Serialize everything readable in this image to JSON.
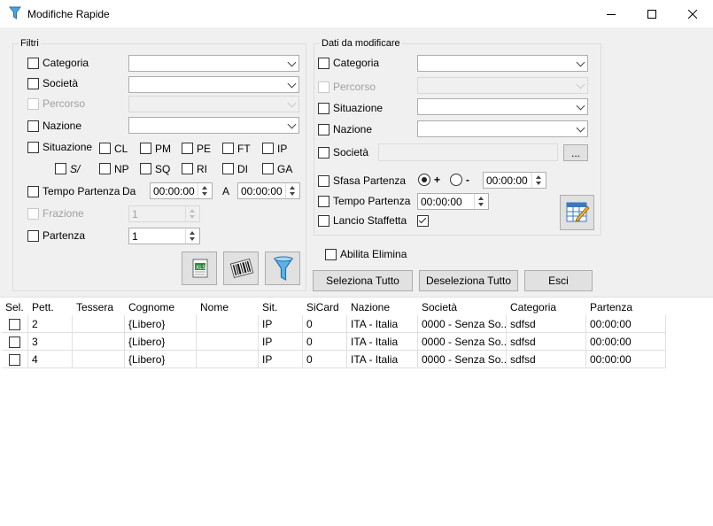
{
  "window": {
    "title": "Modifiche Rapide"
  },
  "filtri": {
    "group_label": "Filtri",
    "categoria_label": "Categoria",
    "societa_label": "Società",
    "percorso_label": "Percorso",
    "nazione_label": "Nazione",
    "situazione_label": "Situazione",
    "situazione_options": [
      "CL",
      "PM",
      "PE",
      "FT",
      "IP",
      "S/",
      "NP",
      "SQ",
      "RI",
      "DI",
      "GA"
    ],
    "tempo_partenza_label": "Tempo Partenza",
    "da_label": "Da",
    "da_value": "00:00:00",
    "a_label": "A",
    "a_value": "00:00:00",
    "frazione_label": "Frazione",
    "frazione_value": "1",
    "partenza_label": "Partenza",
    "partenza_value": "1"
  },
  "dati": {
    "group_label": "Dati da modificare",
    "categoria_label": "Categoria",
    "percorso_label": "Percorso",
    "situazione_label": "Situazione",
    "nazione_label": "Nazione",
    "societa_label": "Società",
    "browse_label": "...",
    "sfasa_label": "Sfasa Partenza",
    "plus_label": "+",
    "minus_label": "-",
    "sfasa_value": "00:00:00",
    "tempo_partenza_label": "Tempo Partenza",
    "tempo_partenza_value": "00:00:00",
    "lancio_label": "Lancio Staffetta"
  },
  "abilita_elimina_label": "Abilita Elimina",
  "buttons": {
    "seleziona": "Seleziona Tutto",
    "deseleziona": "Deseleziona Tutto",
    "esci": "Esci"
  },
  "table": {
    "columns": [
      "Sel.",
      "Pett.",
      "Tessera",
      "Cognome",
      "Nome",
      "Sit.",
      "SiCard",
      "Nazione",
      "Società",
      "Categoria",
      "Partenza"
    ],
    "rows": [
      [
        "",
        "2",
        "",
        "{Libero}",
        "",
        "IP",
        "0",
        "ITA - Italia",
        "0000 - Senza So...",
        "sdfsd",
        "00:00:00"
      ],
      [
        "",
        "3",
        "",
        "{Libero}",
        "",
        "IP",
        "0",
        "ITA - Italia",
        "0000 - Senza So...",
        "sdfsd",
        "00:00:00"
      ],
      [
        "",
        "4",
        "",
        "{Libero}",
        "",
        "IP",
        "0",
        "ITA - Italia",
        "0000 - Senza So...",
        "sdfsd",
        "00:00:00"
      ]
    ]
  },
  "icons": {
    "app": "funnel-icon",
    "minimize": "minimize-icon",
    "maximize": "maximize-icon",
    "close": "close-icon",
    "excel": "excel-icon",
    "barcode": "barcode-icon",
    "filter": "funnel-icon",
    "apply": "edit-table-icon"
  }
}
